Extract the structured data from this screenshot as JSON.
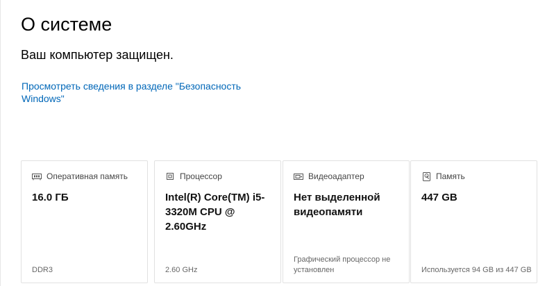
{
  "header": {
    "title": "О системе"
  },
  "status": {
    "text": "Ваш компьютер защищен."
  },
  "security_link": {
    "label": "Просмотреть сведения в разделе \"Безопасность Windows\""
  },
  "cards": [
    {
      "icon": "ram-icon",
      "header": "Оперативная память",
      "value": "16.0 ГБ",
      "footer": "DDR3"
    },
    {
      "icon": "processor-icon",
      "header": "Процессор",
      "value": "Intel(R) Core(TM) i5-3320M CPU @ 2.60GHz",
      "footer": "2.60 GHz"
    },
    {
      "icon": "video-adapter-icon",
      "header": "Видеоадаптер",
      "value": "Нет выделенной видеопамяти",
      "footer": "Графический процессор не установлен"
    },
    {
      "icon": "storage-icon",
      "header": "Память",
      "value": "447 GB",
      "footer": "Используется 94 GB из 447 GB"
    }
  ],
  "colors": {
    "link": "#0067b8",
    "card_border": "#e1e1e1",
    "secondary_text": "#666666"
  }
}
